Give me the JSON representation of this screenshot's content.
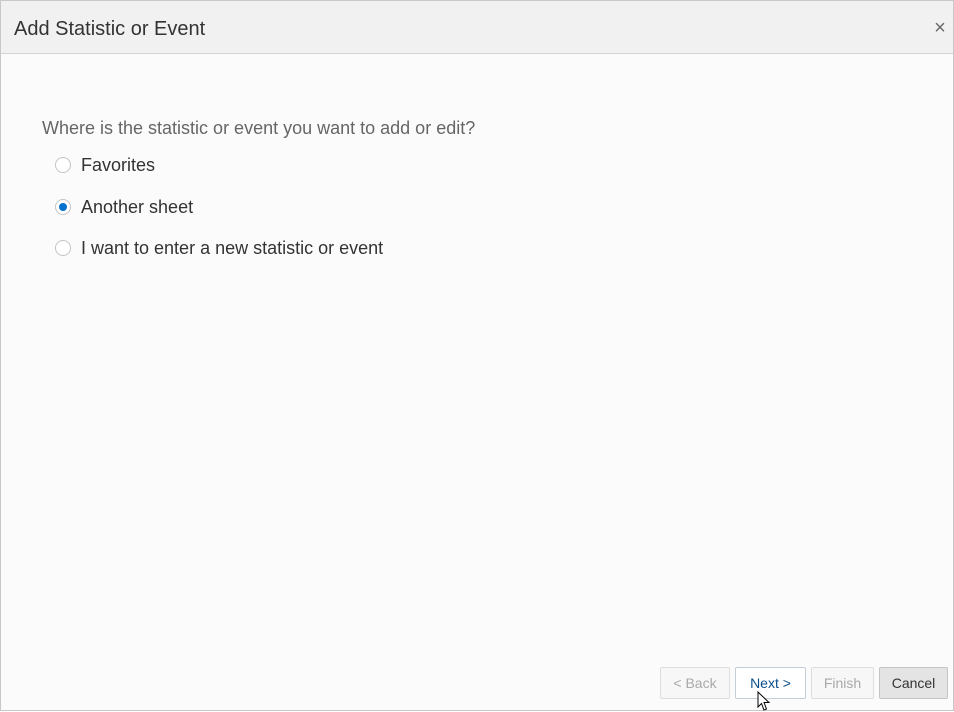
{
  "dialog": {
    "title": "Add Statistic or Event",
    "close_label": "×"
  },
  "question": "Where is the statistic or event you want to add or edit?",
  "options": [
    {
      "label": "Favorites",
      "selected": false
    },
    {
      "label": "Another sheet",
      "selected": true
    },
    {
      "label": "I want to enter a new statistic or event",
      "selected": false
    }
  ],
  "footer": {
    "back_label": "< Back",
    "next_label": "Next >",
    "finish_label": "Finish",
    "cancel_label": "Cancel"
  },
  "colors": {
    "accent": "#0572ce",
    "link_text": "#0b4e8a"
  },
  "icons": {
    "close": "close-icon",
    "pointer": "mouse-pointer-icon"
  }
}
